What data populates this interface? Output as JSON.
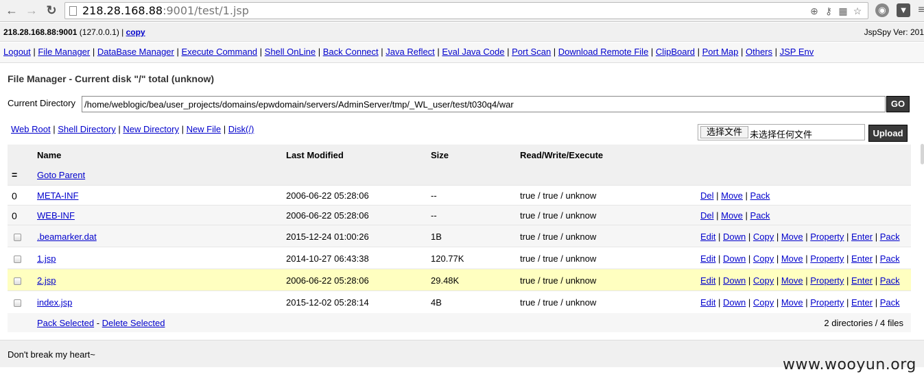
{
  "browser": {
    "back_icon": "arrow-left",
    "forward_icon": "arrow-right",
    "reload_icon": "reload",
    "url_host": "218.28.168.88",
    "url_rest": ":9001/test/1.jsp"
  },
  "info": {
    "host_bold": "218.28.168.88:9001",
    "host_paren": " (127.0.0.1) | ",
    "copy_label": "copy",
    "version": "JspSpy Ver: 201"
  },
  "menu": [
    "Logout",
    "File Manager",
    "DataBase Manager",
    "Execute Command",
    "Shell OnLine",
    "Back Connect",
    "Java Reflect",
    "Eval Java Code",
    "Port Scan",
    "Download Remote File",
    "ClipBoard",
    "Port Map",
    "Others",
    "JSP Env"
  ],
  "main": {
    "title": "File Manager - Current disk \"/\" total (unknow)",
    "cur_dir_label": "Current Directory",
    "cur_dir_value": "/home/weblogic/bea/user_projects/domains/epwdomain/servers/AdminServer/tmp/_WL_user/test/t030q4/war",
    "go_label": "GO",
    "quick_links": [
      "Web Root",
      "Shell Directory",
      "New Directory",
      "New File",
      "Disk(/)"
    ],
    "file_button": "选择文件",
    "file_status": "未选择任何文件",
    "upload_label": "Upload"
  },
  "table": {
    "headers": {
      "name": "Name",
      "modified": "Last Modified",
      "size": "Size",
      "rwx": "Read/Write/Execute"
    },
    "parent_icon": "=",
    "parent_label": "Goto Parent",
    "dir_icon": "0",
    "dirs": [
      {
        "name": "META-INF",
        "modified": "2006-06-22 05:28:06",
        "size": "--",
        "rwx": "true / true / unknow",
        "actions": [
          "Del",
          "Move",
          "Pack"
        ]
      },
      {
        "name": "WEB-INF",
        "modified": "2006-06-22 05:28:06",
        "size": "--",
        "rwx": "true / true / unknow",
        "actions": [
          "Del",
          "Move",
          "Pack"
        ]
      }
    ],
    "files": [
      {
        "name": ".beamarker.dat",
        "modified": "2015-12-24 01:00:26",
        "size": "1B",
        "rwx": "true / true / unknow",
        "actions": [
          "Edit",
          "Down",
          "Copy",
          "Move",
          "Property",
          "Enter",
          "Pack"
        ]
      },
      {
        "name": "1.jsp",
        "modified": "2014-10-27 06:43:38",
        "size": "120.77K",
        "rwx": "true / true / unknow",
        "actions": [
          "Edit",
          "Down",
          "Copy",
          "Move",
          "Property",
          "Enter",
          "Pack"
        ]
      },
      {
        "name": "2.jsp",
        "modified": "2006-06-22 05:28:06",
        "size": "29.48K",
        "rwx": "true / true / unknow",
        "actions": [
          "Edit",
          "Down",
          "Copy",
          "Move",
          "Property",
          "Enter",
          "Pack"
        ]
      },
      {
        "name": "index.jsp",
        "modified": "2015-12-02 05:28:14",
        "size": "4B",
        "rwx": "true / true / unknow",
        "actions": [
          "Edit",
          "Down",
          "Copy",
          "Move",
          "Property",
          "Enter",
          "Pack"
        ]
      }
    ],
    "pack_selected": "Pack Selected",
    "delete_selected": "Delete Selected",
    "selected_sep": " - ",
    "summary": "2 directories / 4 files"
  },
  "footer": {
    "text": "Don't break my heart~"
  },
  "watermark": "www.wooyun.org",
  "colors": {
    "highlight_row": "#ffffc0",
    "row_alt": "#f6f6f6",
    "button_dark": "#3a3a3a",
    "link": "#0000cc"
  }
}
